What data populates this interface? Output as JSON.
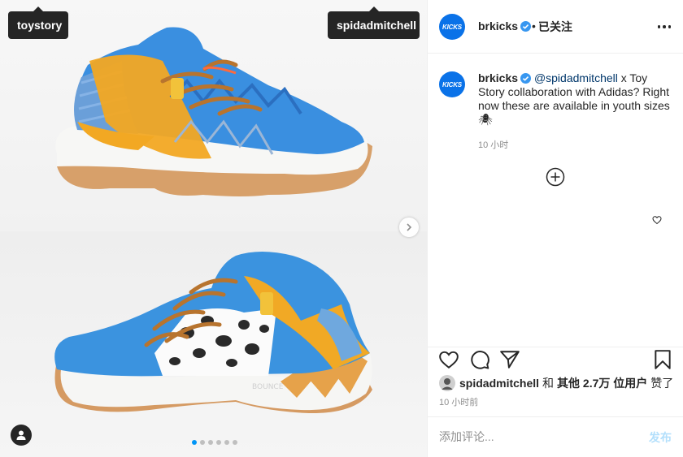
{
  "media": {
    "tags": [
      "toystory",
      "spidadmitchell"
    ]
  },
  "post": {
    "avatar_text": "KICKS",
    "username": "brkicks",
    "dot": "•",
    "follow_status": "已关注",
    "caption": {
      "username": "brkicks",
      "mention": "@spidadmitchell",
      "text": " x Toy Story collaboration with Adidas? Right now these are available in youth sizes 🕷",
      "time": "10 小时"
    },
    "likes": {
      "user": "spidadmitchell",
      "connector": "和",
      "others": "其他 2.7万 位用户",
      "suffix": "赞了"
    },
    "post_time": "10 小时前",
    "comment": {
      "placeholder": "添加评论...",
      "post_label": "发布"
    }
  },
  "carousel": {
    "slides": 6,
    "active_index": 0
  },
  "colors": {
    "accent": "#0095f6",
    "verified": "#3897f0",
    "avatar_bg": "#0a72e8",
    "muted": "#8e8e8e",
    "post_disabled": "#b2dffc"
  }
}
